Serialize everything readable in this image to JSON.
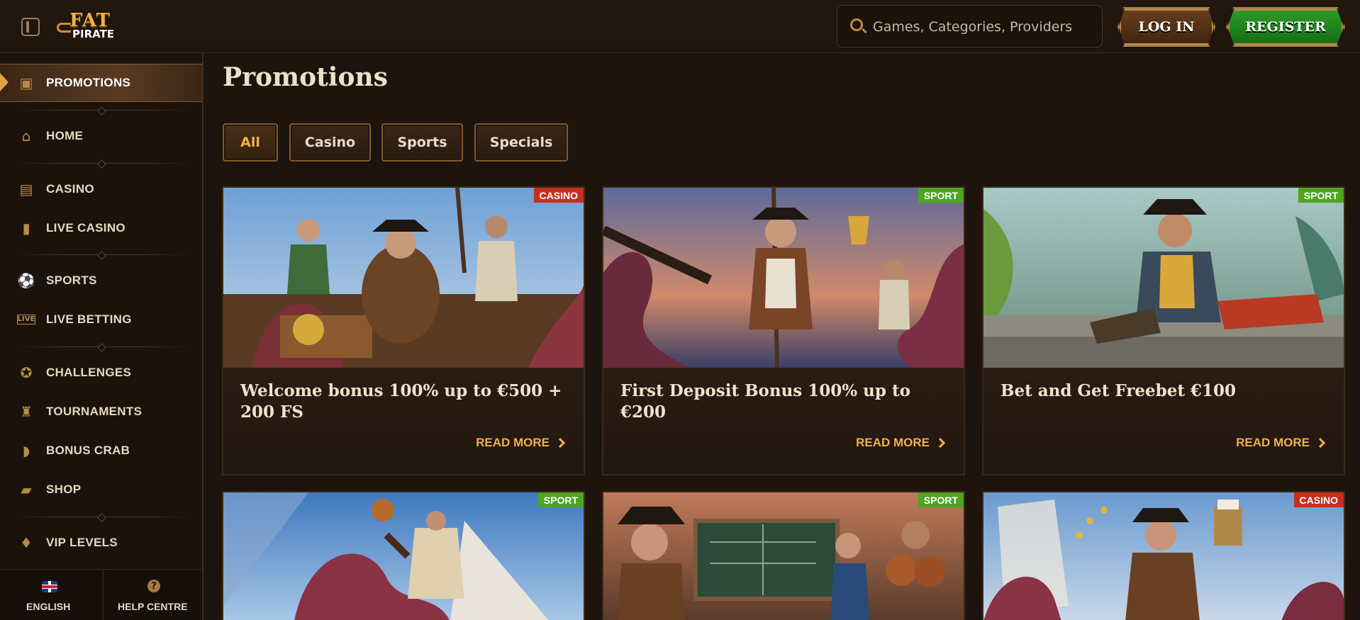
{
  "header": {
    "logo_top": "FAT",
    "logo_bottom": "PIRATE",
    "search_placeholder": "Games, Categories, Providers",
    "login_label": "LOG IN",
    "register_label": "REGISTER"
  },
  "sidebar": {
    "items": [
      {
        "label": "PROMOTIONS",
        "icon": "treasure-chest-icon",
        "active": true
      },
      {
        "label": "HOME",
        "icon": "house-icon"
      },
      {
        "label": "CASINO",
        "icon": "slot-machine-icon"
      },
      {
        "label": "LIVE CASINO",
        "icon": "card-icon"
      },
      {
        "label": "SPORTS",
        "icon": "football-icon"
      },
      {
        "label": "LIVE BETTING",
        "icon": "live-icon"
      },
      {
        "label": "CHALLENGES",
        "icon": "badge-icon"
      },
      {
        "label": "TOURNAMENTS",
        "icon": "trophy-icon"
      },
      {
        "label": "BONUS CRAB",
        "icon": "crab-claw-icon"
      },
      {
        "label": "SHOP",
        "icon": "shopping-bag-icon"
      },
      {
        "label": "VIP LEVELS",
        "icon": "diamond-icon"
      }
    ],
    "footer": {
      "language": "ENGLISH",
      "help": "HELP CENTRE",
      "help_icon_glyph": "?"
    }
  },
  "main": {
    "title": "Promotions",
    "filters": [
      "All",
      "Casino",
      "Sports",
      "Specials"
    ],
    "active_filter": "All",
    "cards": [
      {
        "tag": "CASINO",
        "title": "Welcome bonus 100% up to €500 + 200 FS",
        "cta": "READ MORE"
      },
      {
        "tag": "SPORT",
        "title": "First Deposit Bonus 100% up to €200",
        "cta": "READ MORE"
      },
      {
        "tag": "SPORT",
        "title": "Bet and Get Freebet €100",
        "cta": "READ MORE"
      },
      {
        "tag": "SPORT",
        "title": "",
        "cta": ""
      },
      {
        "tag": "SPORT",
        "title": "",
        "cta": ""
      },
      {
        "tag": "CASINO",
        "title": "",
        "cta": ""
      }
    ]
  },
  "colors": {
    "background": "#1d140e",
    "accent": "#f0b04b",
    "casino_tag": "#c5301f",
    "sport_tag": "#4ea521",
    "register_green": "#2f9c2a"
  }
}
